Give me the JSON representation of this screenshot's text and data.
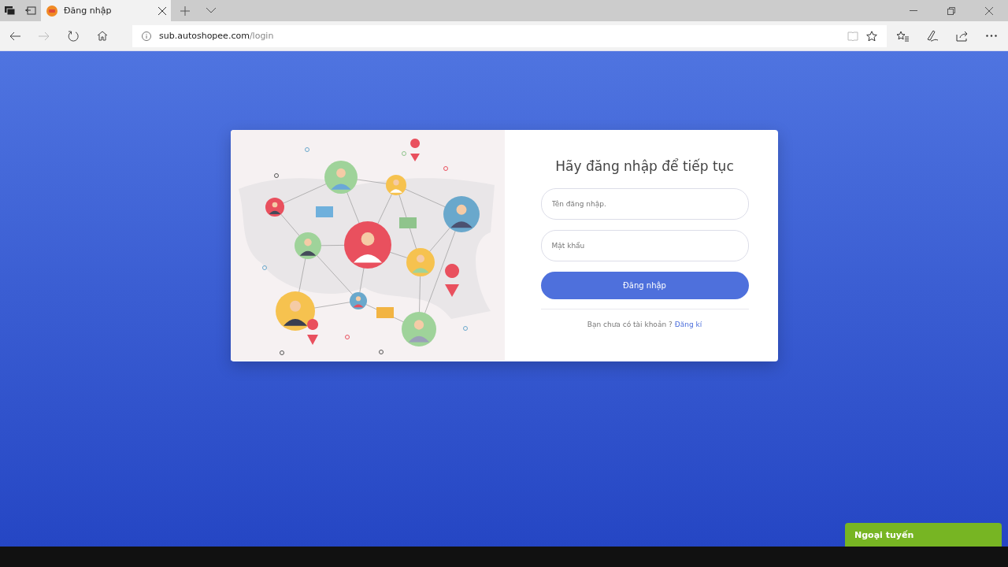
{
  "browser": {
    "tab": {
      "title": "Đăng nhập",
      "selected": true
    },
    "address": {
      "host": "sub.autoshopee.com",
      "path": "/login"
    }
  },
  "login": {
    "heading": "Hãy đăng nhập để tiếp tục",
    "fields": [
      {
        "placeholder": "Tên đăng nhập."
      },
      {
        "placeholder": "Mật khẩu"
      }
    ],
    "submit": "Đăng nhập",
    "signup_prompt": "Bạn chưa có tài khoản ?",
    "signup_link": "Đăng kí"
  },
  "chat_widget": {
    "status": "Ngoại tuyến"
  }
}
